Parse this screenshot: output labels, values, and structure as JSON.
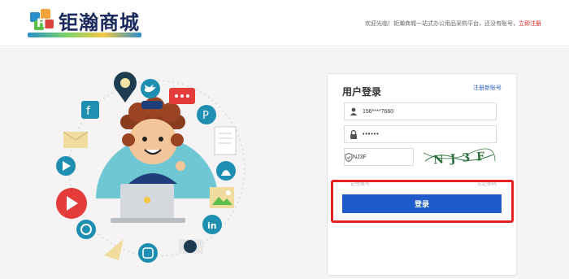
{
  "header": {
    "logo_text": "钜瀚商城",
    "welcome_text": "欢迎光临！钜瀚商城一站式办公用品采购平台，还没有账号，",
    "register_link": "立即注册"
  },
  "login": {
    "title": "用户登录",
    "register_link": "注册新账号",
    "phone_value": "156****7660",
    "password_value": "••••••",
    "code_value": "NJ3F",
    "captcha_text": "NJ3F",
    "faint_left": "记住账号",
    "faint_right": "忘记密码",
    "login_button": "登录"
  },
  "icons": {
    "user": "user-icon",
    "lock": "lock-icon",
    "shield": "shield-icon"
  },
  "colors": {
    "brand_blue": "#1f5cc9",
    "highlight_red": "#e52222",
    "background": "#f5f3f3"
  }
}
